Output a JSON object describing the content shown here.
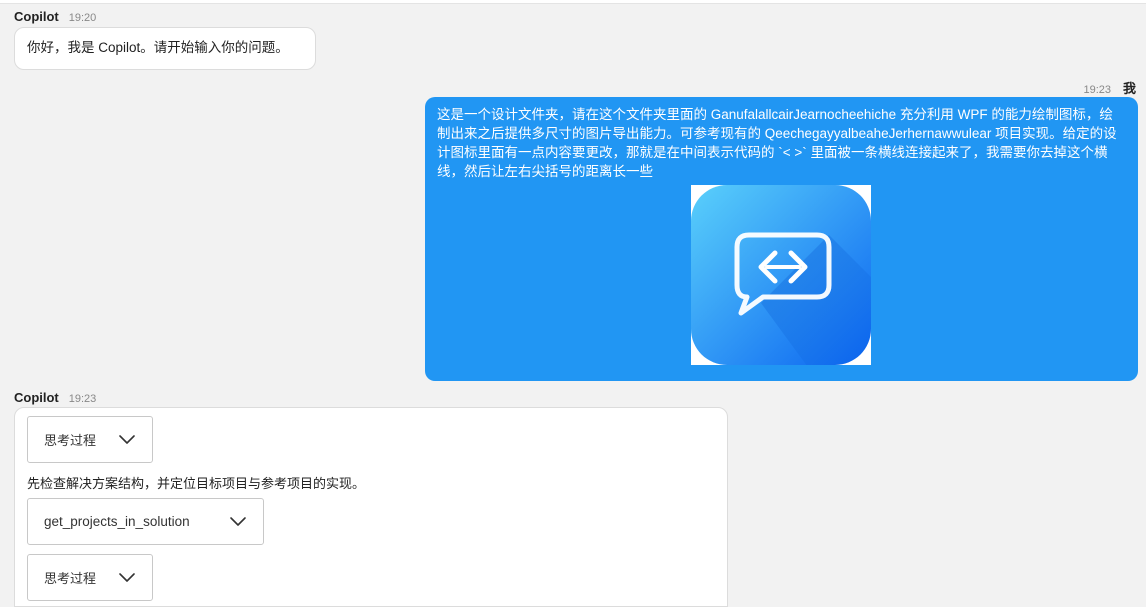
{
  "messages": [
    {
      "sender": "Copilot",
      "time": "19:20",
      "text": "你好，我是 Copilot。请开始输入你的问题。"
    },
    {
      "sender": "我",
      "time": "19:23",
      "text": "这是一个设计文件夹，请在这个文件夹里面的  GanufalallcairJearnocheehiche 充分利用 WPF 的能力绘制图标，绘制出来之后提供多尺寸的图片导出能力。可参考现有的 QeechegayyalbeaheJerhernawwulear 项目实现。给定的设计图标里面有一点内容要更改，那就是在中间表示代码的 `< >` 里面被一条横线连接起来了，我需要你去掉这个横线，然后让左右尖括号的距离长一些",
      "image_icon": "chat-code-icon"
    },
    {
      "sender": "Copilot",
      "time": "19:23",
      "thinking_label_1": "思考过程",
      "intro_text": "先检查解决方案结构，并定位目标项目与参考项目的实现。",
      "tool_call_label": "get_projects_in_solution",
      "thinking_label_2": "思考过程"
    }
  ],
  "colors": {
    "user_bubble": "#2196f3",
    "page_bg": "#f2f2f2",
    "icon_gradient_top": "#4fc3f7",
    "icon_gradient_bottom": "#1565ff"
  }
}
